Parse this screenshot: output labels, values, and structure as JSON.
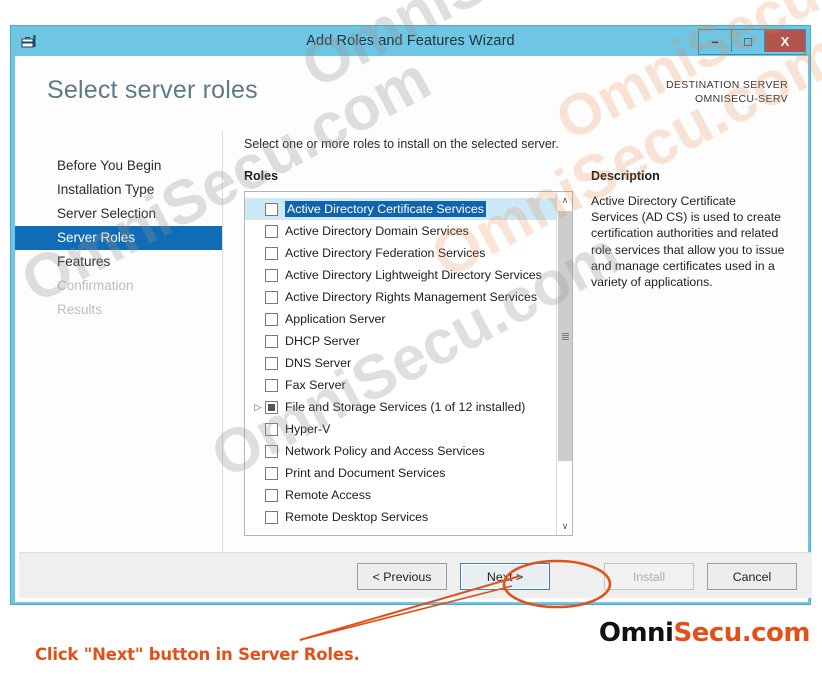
{
  "window": {
    "title": "Add Roles and Features Wizard",
    "icon": "server-manager-icon",
    "minimize_label": "–",
    "maximize_label": "□",
    "close_label": "X",
    "titlebar_color": "#6fc5e4",
    "close_color": "#b4554d"
  },
  "header": {
    "page_title": "Select server roles",
    "destination_label": "DESTINATION SERVER",
    "destination_server": "OMNISECU-SERV"
  },
  "sidebar": {
    "items": [
      {
        "label": "Before You Begin",
        "state": "normal"
      },
      {
        "label": "Installation Type",
        "state": "normal"
      },
      {
        "label": "Server Selection",
        "state": "normal"
      },
      {
        "label": "Server Roles",
        "state": "active"
      },
      {
        "label": "Features",
        "state": "normal"
      },
      {
        "label": "Confirmation",
        "state": "disabled"
      },
      {
        "label": "Results",
        "state": "disabled"
      }
    ],
    "active_color": "#0f6cb5"
  },
  "content": {
    "instruction": "Select one or more roles to install on the selected server.",
    "roles_label": "Roles",
    "description_label": "Description",
    "description_body": "Active Directory Certificate Services (AD CS) is used to create certification authorities and related role services that allow you to issue and manage certificates used in a variety of applications.",
    "roles": [
      {
        "label": "Active Directory Certificate Services",
        "checked": "unchecked",
        "selected": true,
        "expandable": false
      },
      {
        "label": "Active Directory Domain Services",
        "checked": "unchecked",
        "selected": false,
        "expandable": false
      },
      {
        "label": "Active Directory Federation Services",
        "checked": "unchecked",
        "selected": false,
        "expandable": false
      },
      {
        "label": "Active Directory Lightweight Directory Services",
        "checked": "unchecked",
        "selected": false,
        "expandable": false
      },
      {
        "label": "Active Directory Rights Management Services",
        "checked": "unchecked",
        "selected": false,
        "expandable": false
      },
      {
        "label": "Application Server",
        "checked": "unchecked",
        "selected": false,
        "expandable": false
      },
      {
        "label": "DHCP Server",
        "checked": "unchecked",
        "selected": false,
        "expandable": false
      },
      {
        "label": "DNS Server",
        "checked": "unchecked",
        "selected": false,
        "expandable": false
      },
      {
        "label": "Fax Server",
        "checked": "unchecked",
        "selected": false,
        "expandable": false
      },
      {
        "label": "File and Storage Services (1 of 12 installed)",
        "checked": "partial",
        "selected": false,
        "expandable": true
      },
      {
        "label": "Hyper-V",
        "checked": "unchecked",
        "selected": false,
        "expandable": false
      },
      {
        "label": "Network Policy and Access Services",
        "checked": "unchecked",
        "selected": false,
        "expandable": false
      },
      {
        "label": "Print and Document Services",
        "checked": "unchecked",
        "selected": false,
        "expandable": false
      },
      {
        "label": "Remote Access",
        "checked": "unchecked",
        "selected": false,
        "expandable": false
      },
      {
        "label": "Remote Desktop Services",
        "checked": "unchecked",
        "selected": false,
        "expandable": false
      }
    ],
    "scrollbar": {
      "up_arrow": "∧",
      "down_arrow": "∨"
    }
  },
  "footer": {
    "previous_label": "< Previous",
    "next_label": "Next >",
    "install_label": "Install",
    "cancel_label": "Cancel"
  },
  "annotation": {
    "caption": "Click \"Next\" button in Server Roles.",
    "color": "#e0521a",
    "highlight_target": "next-button"
  },
  "branding": {
    "logo_part1": "Omni",
    "logo_part2": "Secu.com",
    "logo_color1": "#111111",
    "logo_color2": "#e0521a",
    "watermark_text": "OmniSecu.com"
  }
}
